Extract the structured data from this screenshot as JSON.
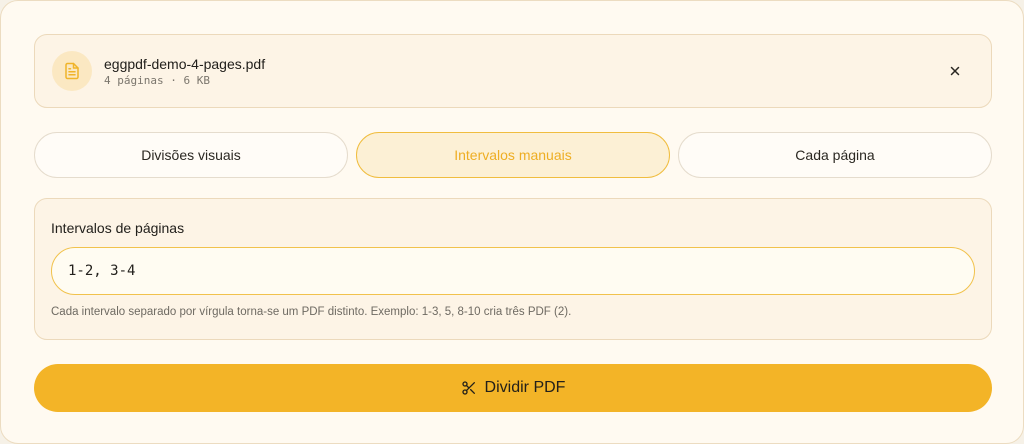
{
  "file": {
    "name": "eggpdf-demo-4-pages.pdf",
    "meta": "4 páginas · 6 KB",
    "icon": "file-text-icon",
    "close_icon": "close-icon"
  },
  "tabs": [
    {
      "label": "Divisões visuais",
      "active": false
    },
    {
      "label": "Intervalos manuais",
      "active": true
    },
    {
      "label": "Cada página",
      "active": false
    }
  ],
  "ranges": {
    "label": "Intervalos de páginas",
    "value": "1-2, 3-4",
    "hint": "Cada intervalo separado por vírgula torna-se um PDF distinto. Exemplo: 1-3, 5, 8-10 cria três PDF (2)."
  },
  "action": {
    "label": "Dividir PDF",
    "icon": "scissors-icon"
  },
  "colors": {
    "accent": "#f3b427",
    "accent_text": "#eeae24",
    "background": "#fffaf1"
  }
}
